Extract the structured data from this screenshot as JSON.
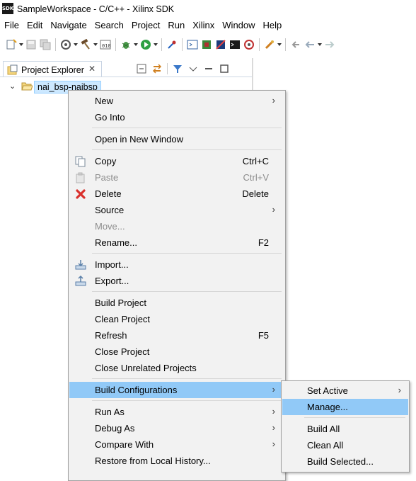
{
  "window": {
    "title": "SampleWorkspace - C/C++ - Xilinx SDK",
    "logo_text": "SDK"
  },
  "menubar": [
    "File",
    "Edit",
    "Navigate",
    "Search",
    "Project",
    "Run",
    "Xilinx",
    "Window",
    "Help"
  ],
  "explorer": {
    "tab_title": "Project Explorer",
    "close_glyph": "✕",
    "tree": {
      "expand_glyph": "⌄",
      "project_label": "nai_bsp-naibsp"
    }
  },
  "context_menu": {
    "items": [
      {
        "label": "New",
        "submenu": true
      },
      {
        "label": "Go Into"
      },
      {
        "label": "Open in New Window"
      },
      {
        "label": "Copy",
        "accel": "Ctrl+C",
        "icon": "copy-icon"
      },
      {
        "label": "Paste",
        "accel": "Ctrl+V",
        "icon": "paste-icon",
        "disabled": true
      },
      {
        "label": "Delete",
        "accel": "Delete",
        "icon": "delete-icon"
      },
      {
        "label": "Source",
        "submenu": true
      },
      {
        "label": "Move...",
        "disabled": true
      },
      {
        "label": "Rename...",
        "accel": "F2"
      },
      {
        "label": "Import...",
        "icon": "import-icon"
      },
      {
        "label": "Export...",
        "icon": "export-icon"
      },
      {
        "label": "Build Project"
      },
      {
        "label": "Clean Project"
      },
      {
        "label": "Refresh",
        "accel": "F5"
      },
      {
        "label": "Close Project"
      },
      {
        "label": "Close Unrelated Projects"
      },
      {
        "label": "Build Configurations",
        "submenu": true,
        "highlighted": true
      },
      {
        "label": "Run As",
        "submenu": true
      },
      {
        "label": "Debug As",
        "submenu": true
      },
      {
        "label": "Compare With",
        "submenu": true
      },
      {
        "label": "Restore from Local History..."
      }
    ],
    "submenu_glyph": "›"
  },
  "build_config_submenu": {
    "items": [
      {
        "label": "Set Active",
        "submenu": true
      },
      {
        "label": "Manage...",
        "highlighted": true
      },
      {
        "label": "Build All"
      },
      {
        "label": "Clean All"
      },
      {
        "label": "Build Selected..."
      }
    ]
  },
  "colors": {
    "highlight": "#91c9f7",
    "menu_bg": "#f2f2f2",
    "selection": "#cce8ff",
    "delete_red": "#d9302c",
    "run_green": "#2ea043"
  }
}
